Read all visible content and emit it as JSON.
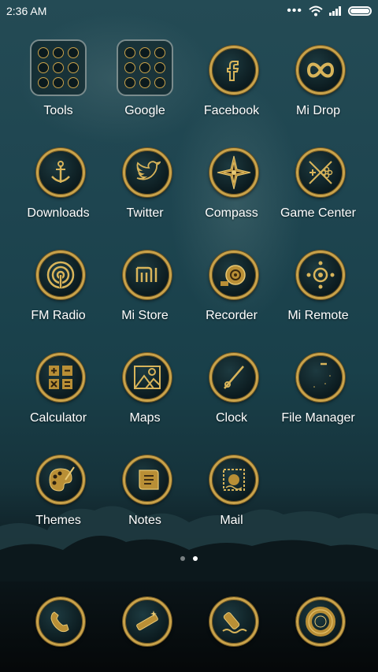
{
  "status": {
    "time": "2:36 AM"
  },
  "apps": [
    {
      "label": "Tools",
      "icon": "folder-icon"
    },
    {
      "label": "Google",
      "icon": "folder-icon"
    },
    {
      "label": "Facebook",
      "icon": "facebook-icon"
    },
    {
      "label": "Mi Drop",
      "icon": "infinity-icon"
    },
    {
      "label": "Downloads",
      "icon": "anchor-icon"
    },
    {
      "label": "Twitter",
      "icon": "bird-icon"
    },
    {
      "label": "Compass",
      "icon": "compass-icon"
    },
    {
      "label": "Game Center",
      "icon": "gamepad-icon"
    },
    {
      "label": "FM Radio",
      "icon": "radio-waves-icon"
    },
    {
      "label": "Mi Store",
      "icon": "mi-logo-icon"
    },
    {
      "label": "Recorder",
      "icon": "reel-icon"
    },
    {
      "label": "Mi Remote",
      "icon": "remote-icon"
    },
    {
      "label": "Calculator",
      "icon": "calculator-icon"
    },
    {
      "label": "Maps",
      "icon": "map-icon"
    },
    {
      "label": "Clock",
      "icon": "clock-hand-icon"
    },
    {
      "label": "File Manager",
      "icon": "file-icon"
    },
    {
      "label": "Themes",
      "icon": "palette-icon"
    },
    {
      "label": "Notes",
      "icon": "scroll-icon"
    },
    {
      "label": "Mail",
      "icon": "stamp-icon"
    }
  ],
  "dock": [
    {
      "icon": "phone-icon"
    },
    {
      "icon": "telescope-icon"
    },
    {
      "icon": "bottle-icon"
    },
    {
      "icon": "life-ring-icon"
    }
  ],
  "pages": {
    "count": 2,
    "active": 1
  },
  "colors": {
    "gold": "#c9a24a",
    "bg_top": "#244b55",
    "bg_bottom": "#050809"
  }
}
